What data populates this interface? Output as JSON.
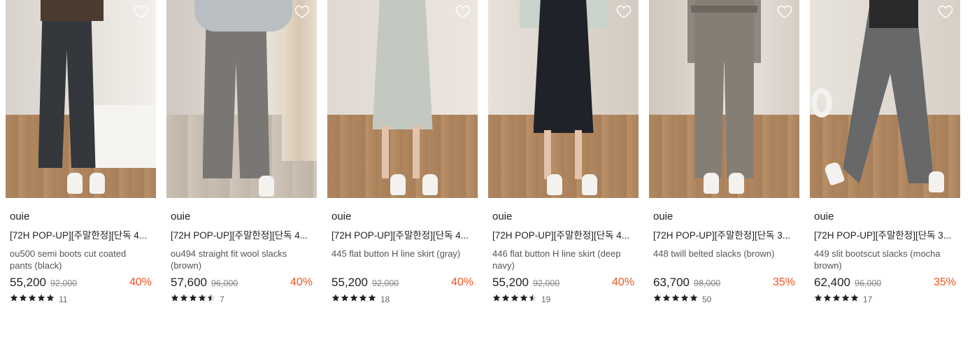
{
  "colors": {
    "discount": "#f0521e",
    "heart": "#ffffff",
    "star": "#222222"
  },
  "products": [
    {
      "brand": "ouie",
      "title": "[72H POP-UP][주말한정][단독 4...",
      "name": "ou500 semi boots cut coated pants (black)",
      "price": "55,200",
      "original_price": "92,000",
      "discount": "40%",
      "rating": 5,
      "reviews": "11",
      "garment": "black-pants"
    },
    {
      "brand": "ouie",
      "title": "[72H POP-UP][주말한정][단독 4...",
      "name": "ou494 straight fit wool slacks (brown)",
      "price": "57,600",
      "original_price": "96,000",
      "discount": "40%",
      "rating": 4.5,
      "reviews": "7",
      "garment": "gray-pants"
    },
    {
      "brand": "ouie",
      "title": "[72H POP-UP][주말한정][단독 4...",
      "name": "445 flat button H line skirt (gray)",
      "price": "55,200",
      "original_price": "92,000",
      "discount": "40%",
      "rating": 5,
      "reviews": "18",
      "garment": "sage-skirt"
    },
    {
      "brand": "ouie",
      "title": "[72H POP-UP][주말한정][단독 4...",
      "name": "446 flat button H line skirt (deep navy)",
      "price": "55,200",
      "original_price": "92,000",
      "discount": "40%",
      "rating": 4.5,
      "reviews": "19",
      "garment": "navy-skirt"
    },
    {
      "brand": "ouie",
      "title": "[72H POP-UP][주말한정][단독 3...",
      "name": "448 twill belted slacks (brown)",
      "price": "63,700",
      "original_price": "98,000",
      "discount": "35%",
      "rating": 5,
      "reviews": "50",
      "garment": "taupe-pants"
    },
    {
      "brand": "ouie",
      "title": "[72H POP-UP][주말한정][단독 3...",
      "name": "449 slit bootscut slacks (mocha brown)",
      "price": "62,400",
      "original_price": "96,000",
      "discount": "35%",
      "rating": 5,
      "reviews": "17",
      "garment": "charcoal-pants"
    }
  ]
}
